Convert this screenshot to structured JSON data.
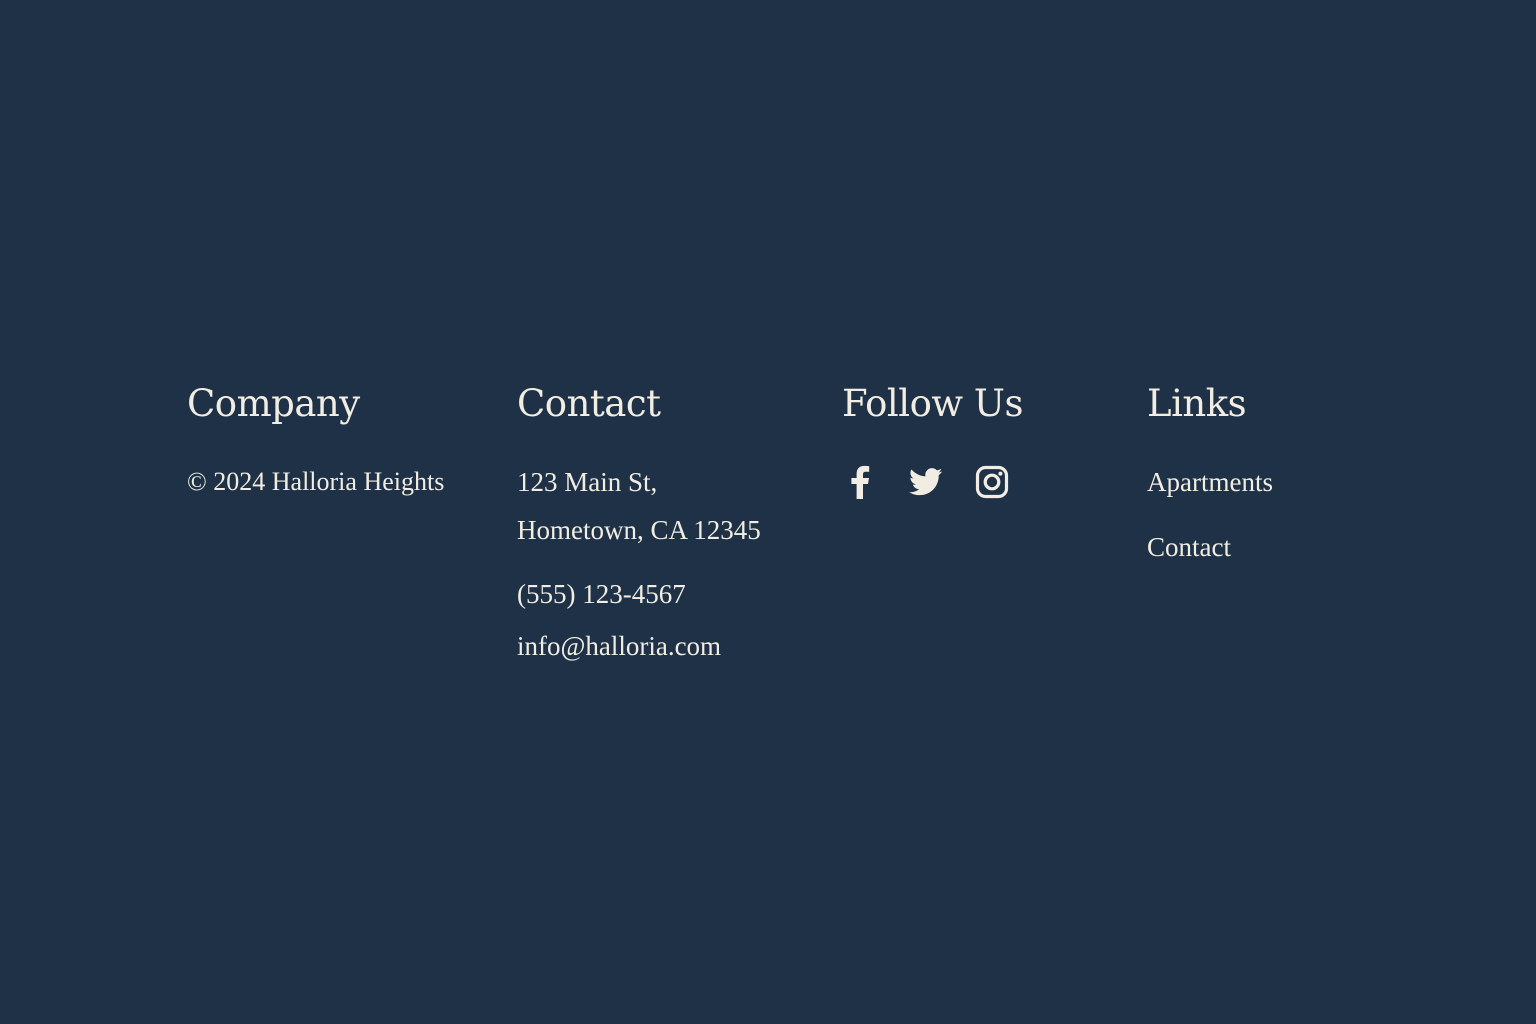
{
  "footer": {
    "company": {
      "heading": "Company",
      "copyright": "© 2024 Halloria Heights"
    },
    "contact": {
      "heading": "Contact",
      "address_line1": "123 Main St,",
      "address_line2": "Hometown, CA 12345",
      "phone": "(555) 123-4567",
      "email": "info@halloria.com"
    },
    "follow": {
      "heading": "Follow Us",
      "icons": [
        "facebook-icon",
        "twitter-icon",
        "instagram-icon"
      ]
    },
    "links": {
      "heading": "Links",
      "items": [
        {
          "label": "Apartments"
        },
        {
          "label": "Contact"
        }
      ]
    }
  },
  "colors": {
    "background": "#1f3146",
    "text": "#f1ede3"
  }
}
